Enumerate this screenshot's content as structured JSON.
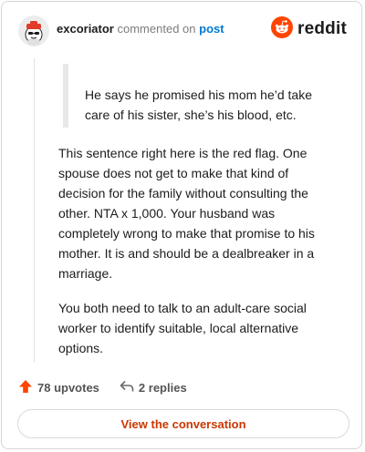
{
  "header": {
    "username": "excoriator",
    "action_text": "commented on",
    "target_link": "post",
    "brand_name": "reddit",
    "brand_color": "#ff4500",
    "avatar_icon": "snoo-avatar-icon"
  },
  "quote": {
    "text": "He says he promised his mom he’d take care of his sister, she’s his blood, etc."
  },
  "comment": {
    "paragraphs": [
      "This sentence right here is the red flag. One spouse does not get to make that kind of decision for the family without consulting the other. NTA x 1,000. Your husband was completely wrong to make that promise to his mother. It is and should be a dealbreaker in a marriage.",
      "You both need to talk to an adult-care social worker to identify suitable, local alternative options."
    ]
  },
  "actions": {
    "upvotes_label": "78 upvotes",
    "replies_label": "2 replies",
    "upvote_icon": "upvote-arrow-icon",
    "reply_icon": "reply-arrow-icon",
    "upvote_color": "#ff4500"
  },
  "cta": {
    "label": "View the conversation",
    "color": "#cc3700"
  }
}
